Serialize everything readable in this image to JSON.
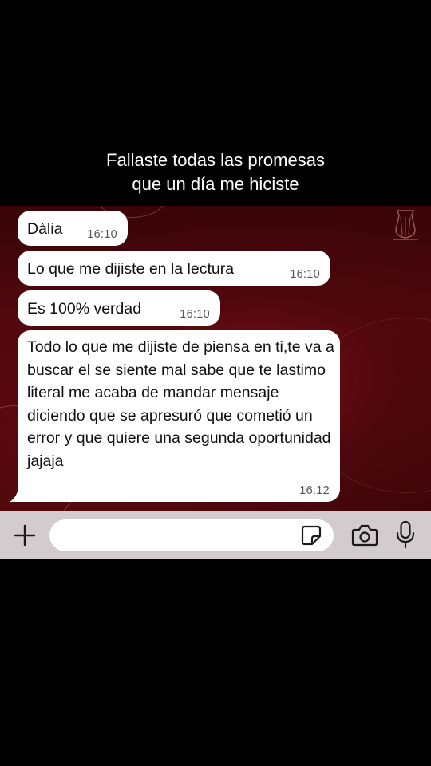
{
  "caption": {
    "line1": "Fallaste todas las promesas",
    "line2": "que un día me hiciste"
  },
  "messages": [
    {
      "text": "Dàlia",
      "time": "16:10"
    },
    {
      "text": "Lo que me dijiste en la lectura",
      "time": "16:10"
    },
    {
      "text": "Es 100% verdad",
      "time": "16:10"
    },
    {
      "text": "Todo lo que me dijiste de piensa en ti,te va a buscar el se siente mal sabe que te lastimo literal me acaba de mandar mensaje diciendo que se apresuró que cometió un error y que quiere una segunda oportunidad jajaja",
      "time": "16:12"
    }
  ],
  "input_bar": {
    "message_value": "",
    "icons": [
      "plus-icon",
      "sticker-icon",
      "camera-icon",
      "microphone-icon"
    ]
  },
  "colors": {
    "chat_background": "#4b070c",
    "bubble": "#ffffff",
    "input_bar": "#d3cccf",
    "caption_text": "#ffffff"
  }
}
